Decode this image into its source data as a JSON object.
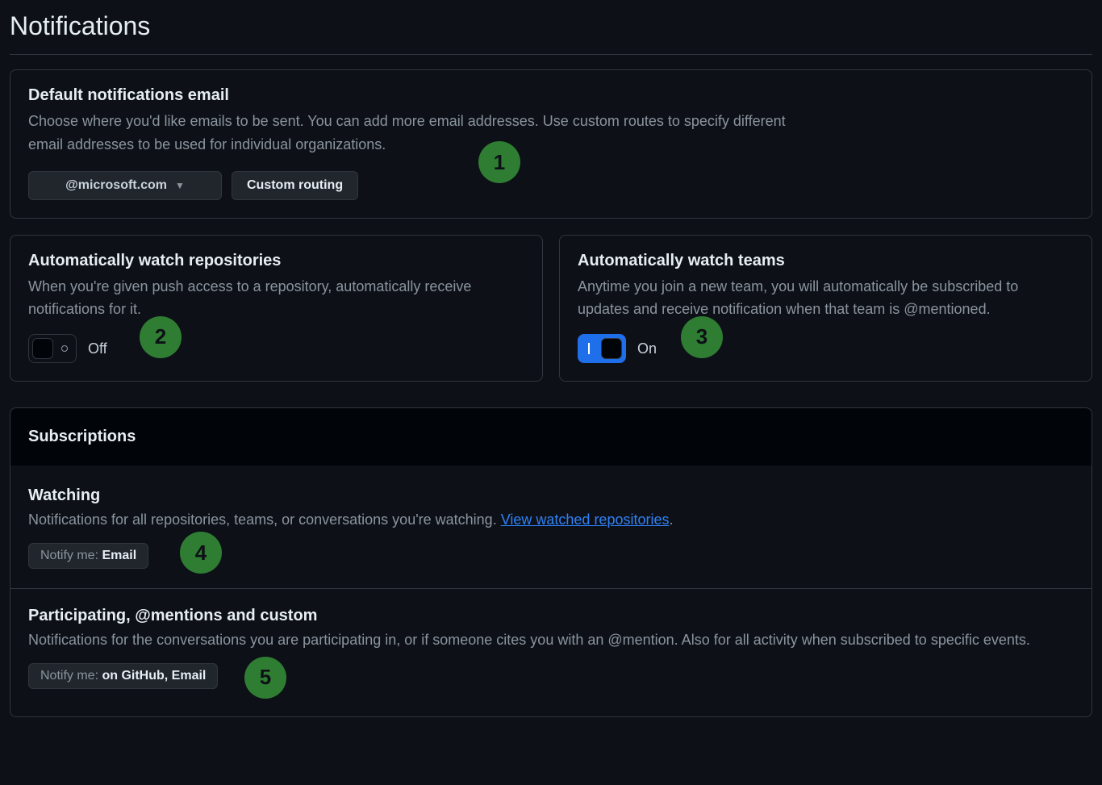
{
  "page": {
    "title": "Notifications"
  },
  "default_email": {
    "title": "Default notifications email",
    "desc": "Choose where you'd like emails to be sent. You can add more email addresses. Use custom routes to specify different email addresses to be used for individual organizations.",
    "selected_email": "@microsoft.com",
    "custom_routing_label": "Custom routing"
  },
  "watch_repos": {
    "title": "Automatically watch repositories",
    "desc": "When you're given push access to a repository, automatically receive notifications for it.",
    "state_label": "Off",
    "state": "off"
  },
  "watch_teams": {
    "title": "Automatically watch teams",
    "desc": "Anytime you join a new team, you will automatically be subscribed to updates and receive notification when that team is @mentioned.",
    "state_label": "On",
    "state": "on"
  },
  "subscriptions": {
    "header": "Subscriptions",
    "watching": {
      "title": "Watching",
      "desc_prefix": "Notifications for all repositories, teams, or conversations you're watching. ",
      "link_text": "View watched repositories",
      "desc_suffix": ".",
      "notify_label": "Notify me: ",
      "notify_value": "Email"
    },
    "participating": {
      "title": "Participating, @mentions and custom",
      "desc": "Notifications for the conversations you are participating in, or if someone cites you with an @mention. Also for all activity when subscribed to specific events.",
      "notify_label": "Notify me: ",
      "notify_value": "on GitHub, Email"
    }
  },
  "markers": {
    "m1": "1",
    "m2": "2",
    "m3": "3",
    "m4": "4",
    "m5": "5"
  }
}
